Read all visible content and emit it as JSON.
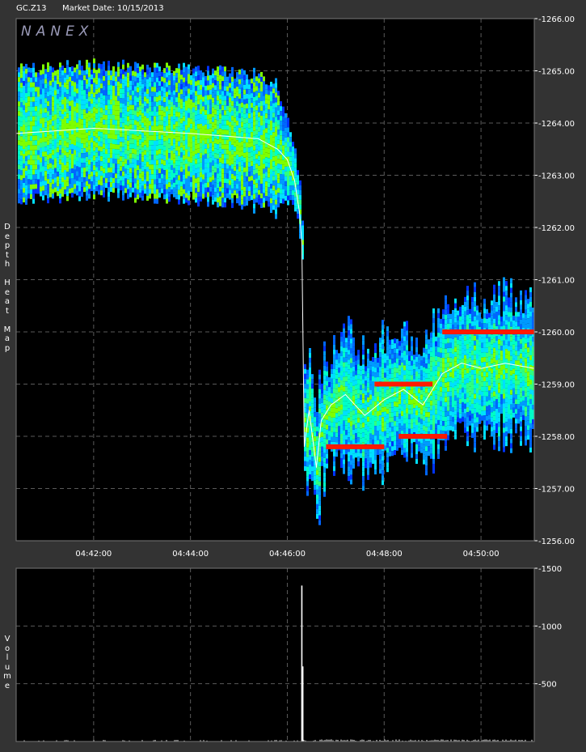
{
  "header": {
    "symbol": "GC.Z13",
    "market_date": "Market Date: 10/15/2013",
    "brand": "NANEX"
  },
  "side_labels": {
    "top": [
      "D",
      "e",
      "p",
      "t",
      "h",
      "",
      "H",
      "e",
      "a",
      "t",
      "",
      "M",
      "a",
      "p"
    ],
    "bottom": [
      "V",
      "o",
      "l",
      "u",
      "m",
      "e"
    ]
  },
  "colors": {
    "frame_bg": "#333333",
    "plot_bg": "#000000",
    "grid": "#5a5a5a",
    "text": "#ffffff",
    "heat_low": "#0033ff",
    "heat_mid": "#00e0ff",
    "heat_high": "#7dff00",
    "heat_max": "#ff1a00",
    "trade": "#ffffff"
  },
  "chart_data": [
    {
      "type": "heatmap",
      "title": "Depth Heat Map",
      "x_ticks": [
        "04:42:00",
        "04:44:00",
        "04:46:00",
        "04:48:00",
        "04:50:00"
      ],
      "x_tick_minutes": [
        2,
        4,
        6,
        8,
        10
      ],
      "x_range_minutes": [
        0.4,
        11.1
      ],
      "y_ticks": [
        1266.0,
        1265.0,
        1264.0,
        1263.0,
        1262.0,
        1261.0,
        1260.0,
        1259.0,
        1258.0,
        1257.0,
        1256.0
      ],
      "ylim": [
        1256.0,
        1266.0
      ],
      "price_path": [
        [
          0.4,
          1263.8
        ],
        [
          2.0,
          1263.9
        ],
        [
          4.0,
          1263.8
        ],
        [
          5.4,
          1263.7
        ],
        [
          5.8,
          1263.5
        ],
        [
          6.0,
          1263.3
        ],
        [
          6.15,
          1262.9
        ],
        [
          6.25,
          1262.3
        ],
        [
          6.3,
          1261.7
        ],
        [
          6.35,
          1257.8
        ],
        [
          6.45,
          1258.5
        ],
        [
          6.6,
          1257.4
        ],
        [
          6.7,
          1258.3
        ],
        [
          6.9,
          1258.6
        ],
        [
          7.2,
          1258.8
        ],
        [
          7.6,
          1258.4
        ],
        [
          8.0,
          1258.7
        ],
        [
          8.4,
          1258.9
        ],
        [
          8.8,
          1258.6
        ],
        [
          9.2,
          1259.2
        ],
        [
          9.6,
          1259.4
        ],
        [
          10.0,
          1259.3
        ],
        [
          10.5,
          1259.4
        ],
        [
          11.1,
          1259.3
        ]
      ],
      "support_levels": [
        {
          "price": 1260.0,
          "from": 9.2,
          "to": 11.1
        },
        {
          "price": 1259.0,
          "from": 7.8,
          "to": 9.0
        },
        {
          "price": 1258.0,
          "from": 8.3,
          "to": 9.3
        },
        {
          "price": 1257.8,
          "from": 6.8,
          "to": 8.0
        }
      ]
    },
    {
      "type": "bar",
      "title": "Volume",
      "y_ticks": [
        1500,
        1000,
        500
      ],
      "ylim": [
        0,
        1500
      ],
      "spike": {
        "minute": 6.3,
        "value": 1350
      },
      "spike2": {
        "minute": 6.32,
        "value": 650
      }
    }
  ]
}
